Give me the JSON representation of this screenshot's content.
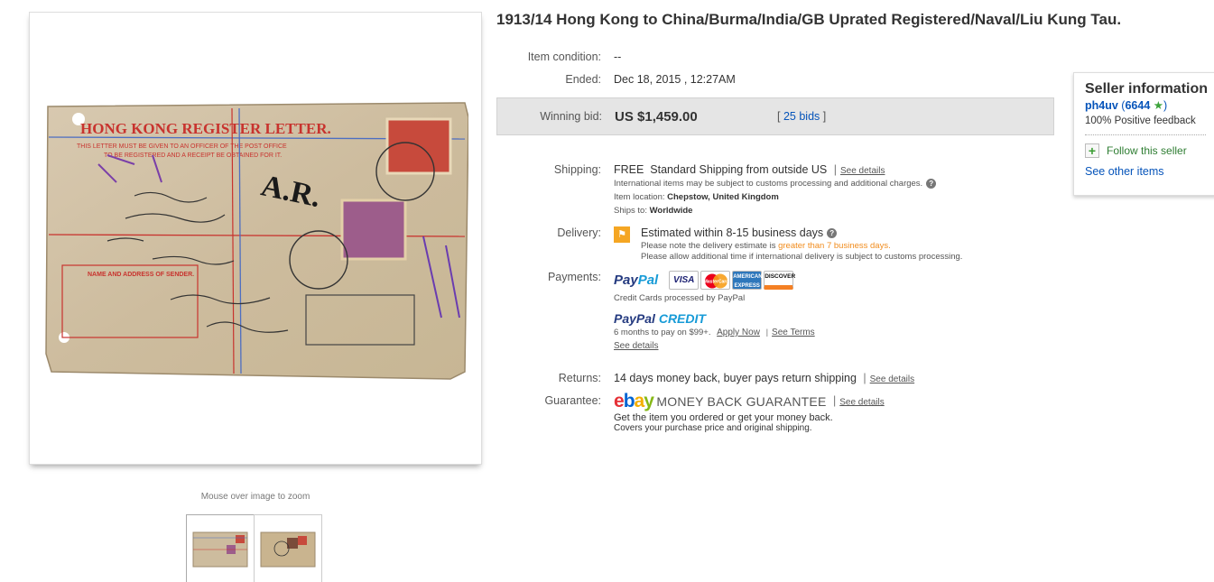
{
  "listing": {
    "title": "1913/14 Hong Kong to China/Burma/India/GB Uprated Registered/Naval/Liu Kung Tau."
  },
  "image": {
    "zoom_hint": "Mouse over image to zoom",
    "envelope_heading": "HONG KONG REGISTER    LETTER.",
    "envelope_line1": "THIS LETTER MUST BE GIVEN TO AN OFFICER OF THE POST OFFICE",
    "envelope_line2": "TO BE REGISTERED AND A RECEIPT BE OBTAINED FOR IT.",
    "box_label": "NAME AND ADDRESS OF SENDER.",
    "ar_mark": "A.R."
  },
  "details": {
    "condition_label": "Item condition:",
    "condition_value": "--",
    "ended_label": "Ended:",
    "ended_value": "Dec 18, 2015 , 12:27AM",
    "winning_label": "Winning bid:",
    "winning_value": "US $1,459.00",
    "bids_open": "[",
    "bids_value": "25 bids",
    "bids_close": "]"
  },
  "shipping": {
    "label": "Shipping:",
    "free": "FREE",
    "method": "Standard Shipping from outside US",
    "see_details": "See details",
    "intl_note": "International items may be subject to customs processing and additional charges.",
    "location_label": "Item location:",
    "location_value": "Chepstow, United Kingdom",
    "ships_label": "Ships to:",
    "ships_value": "Worldwide"
  },
  "delivery": {
    "label": "Delivery:",
    "estimate": "Estimated within 8-15 business days",
    "note_prefix": "Please note the delivery estimate is",
    "note_highlight": "greater than 7 business days.",
    "note2": "Please allow additional time if international delivery is subject to customs processing."
  },
  "payments": {
    "label": "Payments:",
    "paypal_a": "Pay",
    "paypal_b": "Pal",
    "card_visa": "VISA",
    "card_mc": "MasterCard",
    "card_amex": "AMERICAN EXPRESS",
    "card_discover": "DISCOVER",
    "cards_note": "Credit Cards processed by PayPal",
    "credit_a": "PayPal",
    "credit_b": "CREDIT",
    "credit_offer": "6 months to pay on $99+.",
    "apply_now": "Apply Now",
    "see_terms": "See Terms",
    "see_details": "See details"
  },
  "returns": {
    "label": "Returns:",
    "value": "14 days money back, buyer pays return shipping",
    "see_details": "See details"
  },
  "guarantee": {
    "label": "Guarantee:",
    "ebay_e": "e",
    "ebay_b": "b",
    "ebay_a": "a",
    "ebay_y": "y",
    "mbg": "MONEY BACK GUARANTEE",
    "see_details": "See details",
    "line1": "Get the item you ordered or get your money back.",
    "line2": "Covers your purchase price and original shipping."
  },
  "seller": {
    "heading": "Seller information",
    "username": "ph4uv",
    "score": "6644",
    "feedback": "100% Positive feedback",
    "follow": "Follow this seller",
    "other_items": "See other items"
  },
  "colors": {
    "link": "#0654ba",
    "orange": "#f18c1d",
    "paypal_dark": "#253b80",
    "paypal_light": "#179bd7"
  }
}
